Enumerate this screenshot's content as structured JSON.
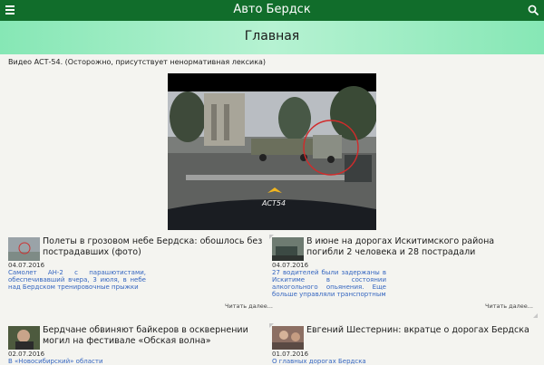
{
  "app": {
    "title": "Авто Бердск"
  },
  "page": {
    "title": "Главная"
  },
  "video": {
    "caption": "Видео АСТ-54. (Осторожно, присутствует ненормативная лексика)",
    "watermark": "АСТ54"
  },
  "more_label": "Читать далее...",
  "articles": [
    {
      "headline": "Полеты в грозовом небе Бердска: обошлось без пострадавших (фото)",
      "date": "04.07.2016",
      "lead": "Самолет АН-2 с парашютистами, обеспечивавший вчера, 3 июля, в небе над Бердском тренировочные прыжки"
    },
    {
      "headline": "В июне на дорогах Искитимского района погибли 2 человека и 28 пострадали",
      "date": "04.07.2016",
      "lead": "27 водителей были задержаны в Искитиме в состоянии алкогольного опьянения. Еще больше управляли транспортным"
    },
    {
      "headline": "Бердчане обвиняют байкеров в осквернении могил на фестивале «Обская волна»",
      "date": "02.07.2016",
      "lead": "В «Новосибирский» области"
    },
    {
      "headline": "Евгений Шестернин: вкратце о дорогах Бердска",
      "date": "01.07.2016",
      "lead": "О главных дорогах Бердска"
    }
  ],
  "colors": {
    "appbar": "#116d2b",
    "accent_gradient": "#86e7b5",
    "lead_text": "#3566c0"
  }
}
